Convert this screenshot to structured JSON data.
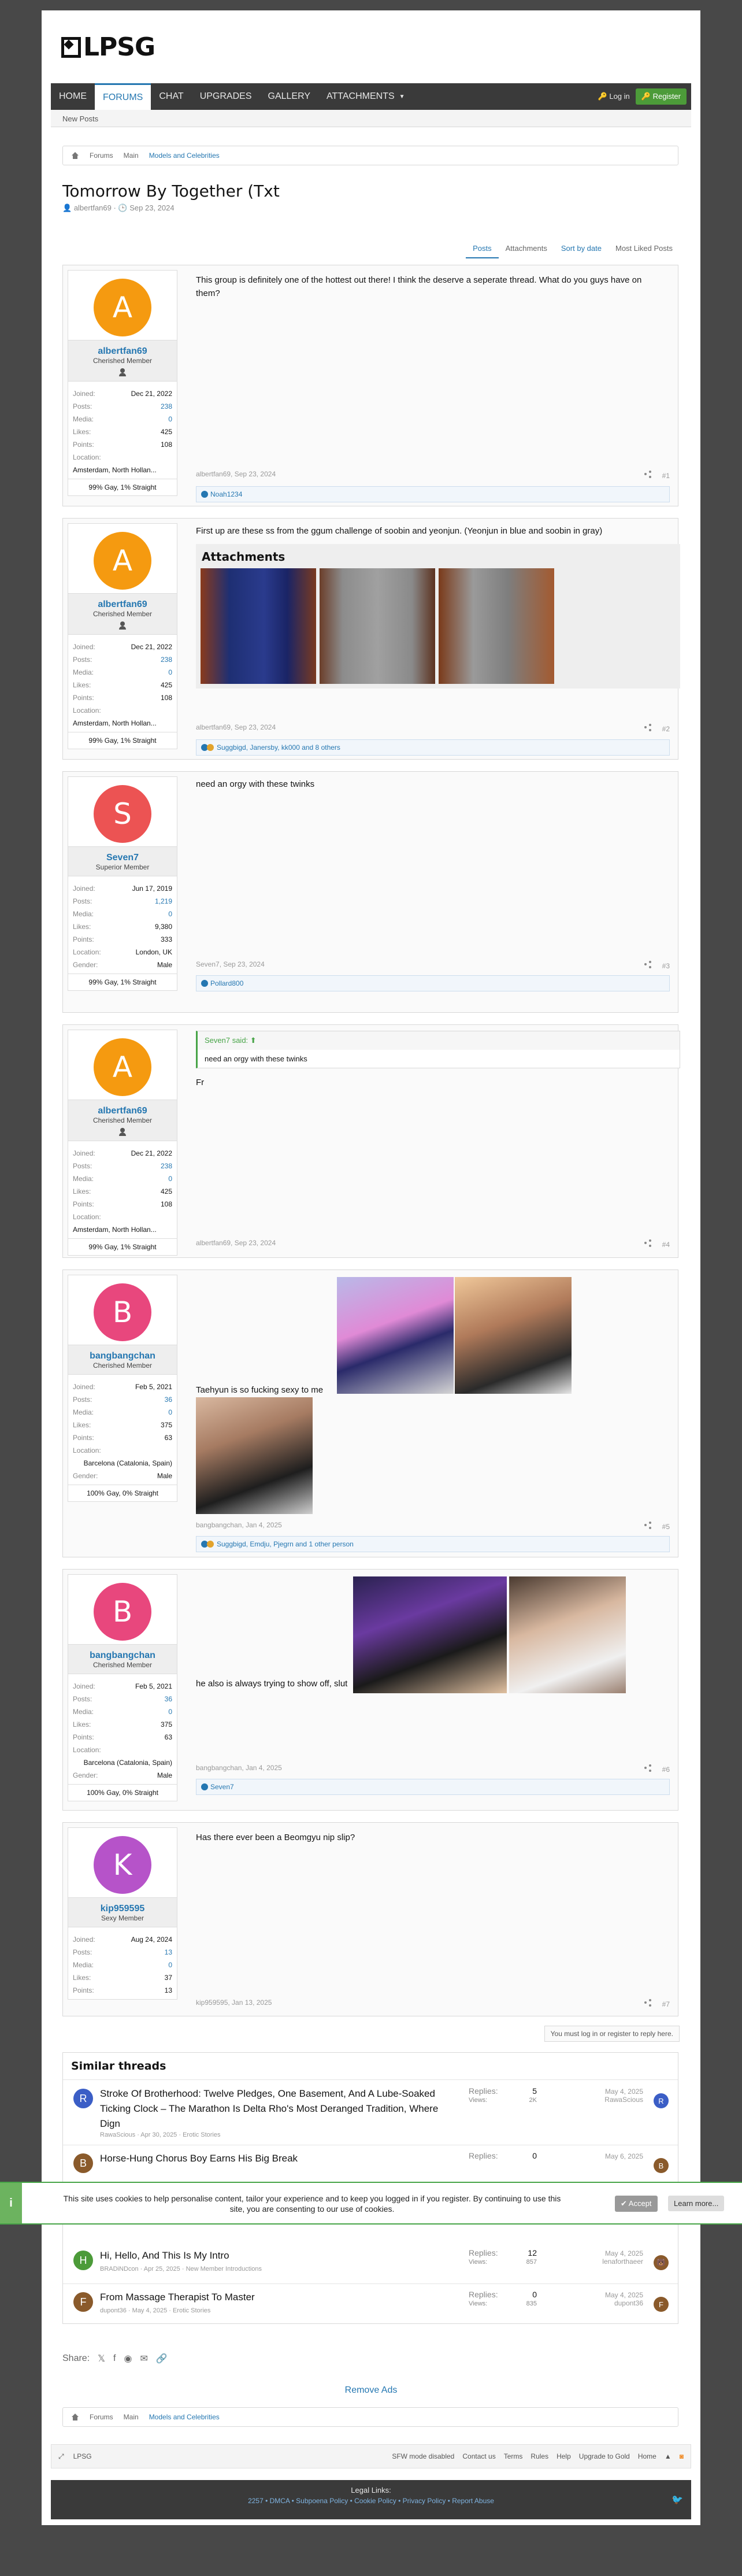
{
  "site": {
    "logo_text": "LPSG",
    "colors": {
      "accent": "#2577b1",
      "nav": "#3a3a3a",
      "register": "#4c9b39"
    }
  },
  "nav": {
    "tabs": [
      "HOME",
      "FORUMS",
      "CHAT",
      "UPGRADES",
      "GALLERY",
      "ATTACHMENTS"
    ],
    "login": "Log in",
    "register": "Register",
    "subnav": "New Posts"
  },
  "breadcrumb": {
    "items": [
      "Forums",
      "Main",
      "Models and Celebrities"
    ]
  },
  "thread": {
    "title": "Tomorrow By Together (Txt",
    "author": "albertfan69",
    "date": "Sep 23, 2024"
  },
  "tabs": {
    "posts": "Posts",
    "attachments": "Attachments",
    "sort": "Sort by date",
    "most_liked": "Most Liked Posts"
  },
  "stat_labels": {
    "joined": "Joined:",
    "posts": "Posts:",
    "media": "Media:",
    "likes": "Likes:",
    "points": "Points:",
    "location": "Location:",
    "gender": "Gender:"
  },
  "posts": [
    {
      "initial": "A",
      "color": "#f59a10",
      "user": "albertfan69",
      "title": "Cherished Member",
      "joined": "Dec 21, 2022",
      "posts": "238",
      "media": "0",
      "likes": "425",
      "points": "108",
      "location": "Amsterdam, North Hollan...",
      "gender": "",
      "orientation": "99% Gay, 1% Straight",
      "text": "This group is definitely one of the hottest out there! I think the deserve a seperate thread. What do you guys have on them?",
      "meta": "albertfan69, Sep 23, 2024",
      "num": "#1",
      "likes_text": "Noah1234"
    },
    {
      "initial": "A",
      "color": "#f59a10",
      "user": "albertfan69",
      "title": "Cherished Member",
      "joined": "Dec 21, 2022",
      "posts": "238",
      "media": "0",
      "likes": "425",
      "points": "108",
      "location": "Amsterdam, North Hollan...",
      "gender": "",
      "orientation": "99% Gay, 1% Straight",
      "text": "First up are these ss from the ggum challenge of soobin and yeonjun. (Yeonjun in blue and soobin in gray)",
      "attachments_title": "Attachments",
      "meta": "albertfan69, Sep 23, 2024",
      "num": "#2",
      "likes_text": "Suggbigd, Janersby, kk000 and 8 others"
    },
    {
      "initial": "S",
      "color": "#ec5353",
      "user": "Seven7",
      "title": "Superior Member",
      "joined": "Jun 17, 2019",
      "posts": "1,219",
      "media": "0",
      "likes": "9,380",
      "points": "333",
      "location": "London, UK",
      "gender": "Male",
      "orientation": "99% Gay, 1% Straight",
      "text": "need an orgy with these twinks",
      "meta": "Seven7, Sep 23, 2024",
      "num": "#3",
      "likes_text": "Pollard800"
    },
    {
      "initial": "A",
      "color": "#f59a10",
      "user": "albertfan69",
      "title": "Cherished Member",
      "joined": "Dec 21, 2022",
      "posts": "238",
      "media": "0",
      "likes": "425",
      "points": "108",
      "location": "Amsterdam, North Hollan...",
      "gender": "",
      "orientation": "99% Gay, 1% Straight",
      "quote_head": "Seven7 said:",
      "quote_body": "need an orgy with these twinks",
      "text": "Fr",
      "meta": "albertfan69, Sep 23, 2024",
      "num": "#4"
    },
    {
      "initial": "B",
      "color": "#e8477d",
      "user": "bangbangchan",
      "title": "Cherished Member",
      "joined": "Feb 5, 2021",
      "posts": "36",
      "media": "0",
      "likes": "375",
      "points": "63",
      "location": "Barcelona (Catalonia, Spain)",
      "gender": "Male",
      "orientation": "100% Gay, 0% Straight",
      "text": "Taehyun is so fucking sexy to me",
      "meta": "bangbangchan, Jan 4, 2025",
      "num": "#5",
      "likes_text": "Suggbigd, Emdju, Pjegrn and 1 other person"
    },
    {
      "initial": "B",
      "color": "#e8477d",
      "user": "bangbangchan",
      "title": "Cherished Member",
      "joined": "Feb 5, 2021",
      "posts": "36",
      "media": "0",
      "likes": "375",
      "points": "63",
      "location": "Barcelona (Catalonia, Spain)",
      "gender": "Male",
      "orientation": "100% Gay, 0% Straight",
      "text": "he also is always trying to show off, slut",
      "meta": "bangbangchan, Jan 4, 2025",
      "num": "#6",
      "likes_text": "Seven7"
    },
    {
      "initial": "K",
      "color": "#b653c9",
      "user": "kip959595",
      "title": "Sexy Member",
      "joined": "Aug 24, 2024",
      "posts": "13",
      "media": "0",
      "likes": "37",
      "points": "13",
      "location": "",
      "gender": "",
      "orientation": "",
      "text": "Has there ever been a Beomgyu nip slip?",
      "meta": "kip959595, Jan 13, 2025",
      "num": "#7"
    }
  ],
  "reply_notice": "You must log in or register to reply here.",
  "similar": {
    "title": "Similar threads",
    "replies_label": "Replies:",
    "views_label": "Views:",
    "rows": [
      {
        "initial": "R",
        "color": "#3b5ec6",
        "title": "Stroke Of Brotherhood: Twelve Pledges, One Basement, And A Lube-Soaked Ticking Clock – The Marathon Is Delta Rho's Most Deranged Tradition, Where Dign",
        "meta": "RawaScious · Apr 30, 2025 · Erotic Stories",
        "replies": "5",
        "views": "2K",
        "date": "May 4, 2025",
        "last": "RawaScious"
      },
      {
        "initial": "B",
        "color": "#8a5a2b",
        "title": "Horse-Hung Chorus Boy Earns His Big Break",
        "meta": "",
        "replies": "0",
        "views": "",
        "date": "May 6, 2025",
        "last": ""
      },
      {
        "initial": "H",
        "color": "#4c9b39",
        "title": "Hi, Hello, And This Is My Intro",
        "meta": "BRADiNDcon · Apr 25, 2025 · New Member Introductions",
        "replies": "12",
        "views": "857",
        "date": "May 4, 2025",
        "last": "lenaforthaeer"
      },
      {
        "initial": "F",
        "color": "#8a5a2b",
        "title": "From Massage Therapist To Master",
        "meta": "dupont36 · May 4, 2025 · Erotic Stories",
        "replies": "0",
        "views": "835",
        "date": "May 4, 2025",
        "last": "dupont36"
      }
    ]
  },
  "cookie": {
    "message": "This site uses cookies to help personalise content, tailor your experience and to keep you logged in if you register. By continuing to use this site, you are consenting to our use of cookies.",
    "accept": "Accept",
    "learn": "Learn more..."
  },
  "share": {
    "label": "Share:"
  },
  "remove_ads": "Remove Ads",
  "footer": {
    "brand": "LPSG",
    "links": [
      "SFW mode disabled",
      "Contact us",
      "Terms",
      "Rules",
      "Help",
      "Upgrade to Gold",
      "Home"
    ],
    "legal_title": "Legal Links:",
    "legal": "2257 • DMCA • Subpoena Policy • Cookie Policy • Privacy Policy • Report Abuse"
  }
}
